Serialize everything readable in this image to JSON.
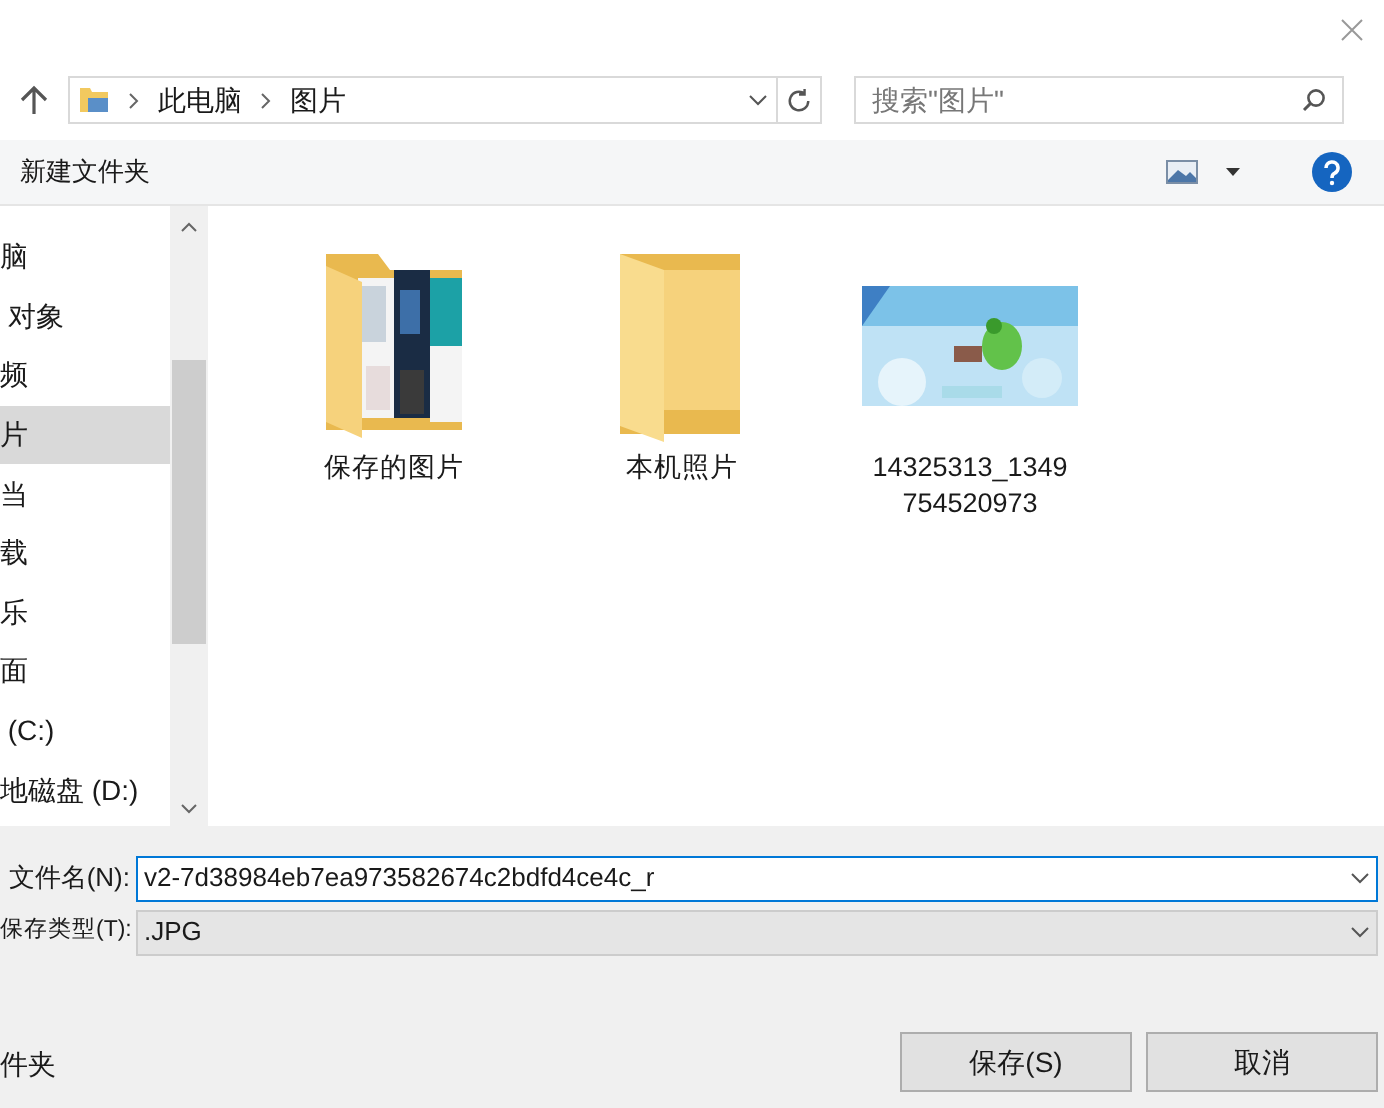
{
  "address_bar": {
    "segments": [
      "此电脑",
      "图片"
    ]
  },
  "search": {
    "placeholder": "搜索\"图片\""
  },
  "toolbar": {
    "new_folder": "新建文件夹"
  },
  "sidebar": {
    "items": [
      {
        "label": "脑",
        "selected": false
      },
      {
        "label": " 对象",
        "selected": false
      },
      {
        "label": "频",
        "selected": false
      },
      {
        "label": "片",
        "selected": true
      },
      {
        "label": "当",
        "selected": false
      },
      {
        "label": "载",
        "selected": false
      },
      {
        "label": "乐",
        "selected": false
      },
      {
        "label": "面",
        "selected": false
      },
      {
        "label": " (C:)",
        "selected": false
      },
      {
        "label": "地磁盘 (D:)",
        "selected": false
      }
    ]
  },
  "files": [
    {
      "kind": "photo-folder",
      "name": "保存的图片"
    },
    {
      "kind": "folder",
      "name": "本机照片"
    },
    {
      "name": "14325313_1349754520973"
    }
  ],
  "file_name": {
    "label": "文件名(N):",
    "value": "v2-7d38984eb7ea973582674c2bdfd4ce4c_r"
  },
  "file_type": {
    "label": "保存类型(T):",
    "value": ".JPG"
  },
  "hide_folders": "件夹",
  "buttons": [
    "保存(S)",
    "取消"
  ]
}
